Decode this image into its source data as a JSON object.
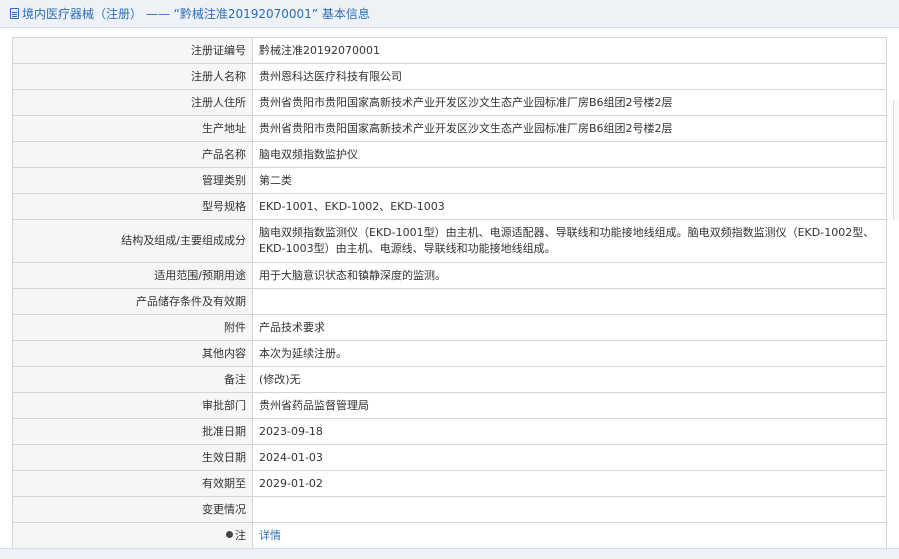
{
  "header": {
    "title": "境内医疗器械（注册） —— “黔械注准20192070001” 基本信息"
  },
  "rows": [
    {
      "label": "注册证编号",
      "value": "黔械注准20192070001"
    },
    {
      "label": "注册人名称",
      "value": "贵州恩科达医疗科技有限公司"
    },
    {
      "label": "注册人住所",
      "value": "贵州省贵阳市贵阳国家高新技术产业开发区沙文生态产业园标准厂房B6组团2号楼2层"
    },
    {
      "label": "生产地址",
      "value": "贵州省贵阳市贵阳国家高新技术产业开发区沙文生态产业园标准厂房B6组团2号楼2层"
    },
    {
      "label": "产品名称",
      "value": "脑电双频指数监护仪"
    },
    {
      "label": "管理类别",
      "value": "第二类"
    },
    {
      "label": "型号规格",
      "value": "EKD-1001、EKD-1002、EKD-1003"
    },
    {
      "label": "结构及组成/主要组成成分",
      "value": "脑电双频指数监测仪（EKD-1001型）由主机、电源适配器、导联线和功能接地线组成。脑电双频指数监测仪（EKD-1002型、EKD-1003型）由主机、电源线、导联线和功能接地线组成。"
    },
    {
      "label": "适用范围/预期用途",
      "value": "用于大脑意识状态和镇静深度的监测。"
    },
    {
      "label": "产品储存条件及有效期",
      "value": ""
    },
    {
      "label": "附件",
      "value": "产品技术要求"
    },
    {
      "label": "其他内容",
      "value": "本次为延续注册。"
    },
    {
      "label": "备注",
      "value": "(修改)无"
    },
    {
      "label": "审批部门",
      "value": "贵州省药品监督管理局"
    },
    {
      "label": "批准日期",
      "value": "2023-09-18"
    },
    {
      "label": "生效日期",
      "value": "2024-01-03"
    },
    {
      "label": "有效期至",
      "value": "2029-01-02"
    },
    {
      "label": "变更情况",
      "value": ""
    }
  ],
  "note_row": {
    "label": "注",
    "link_text": "详情",
    "icon": "pin-icon"
  },
  "colors": {
    "accent": "#2b6fb7",
    "label_bg": "#f6f6f6",
    "border": "#d4d4d4"
  }
}
